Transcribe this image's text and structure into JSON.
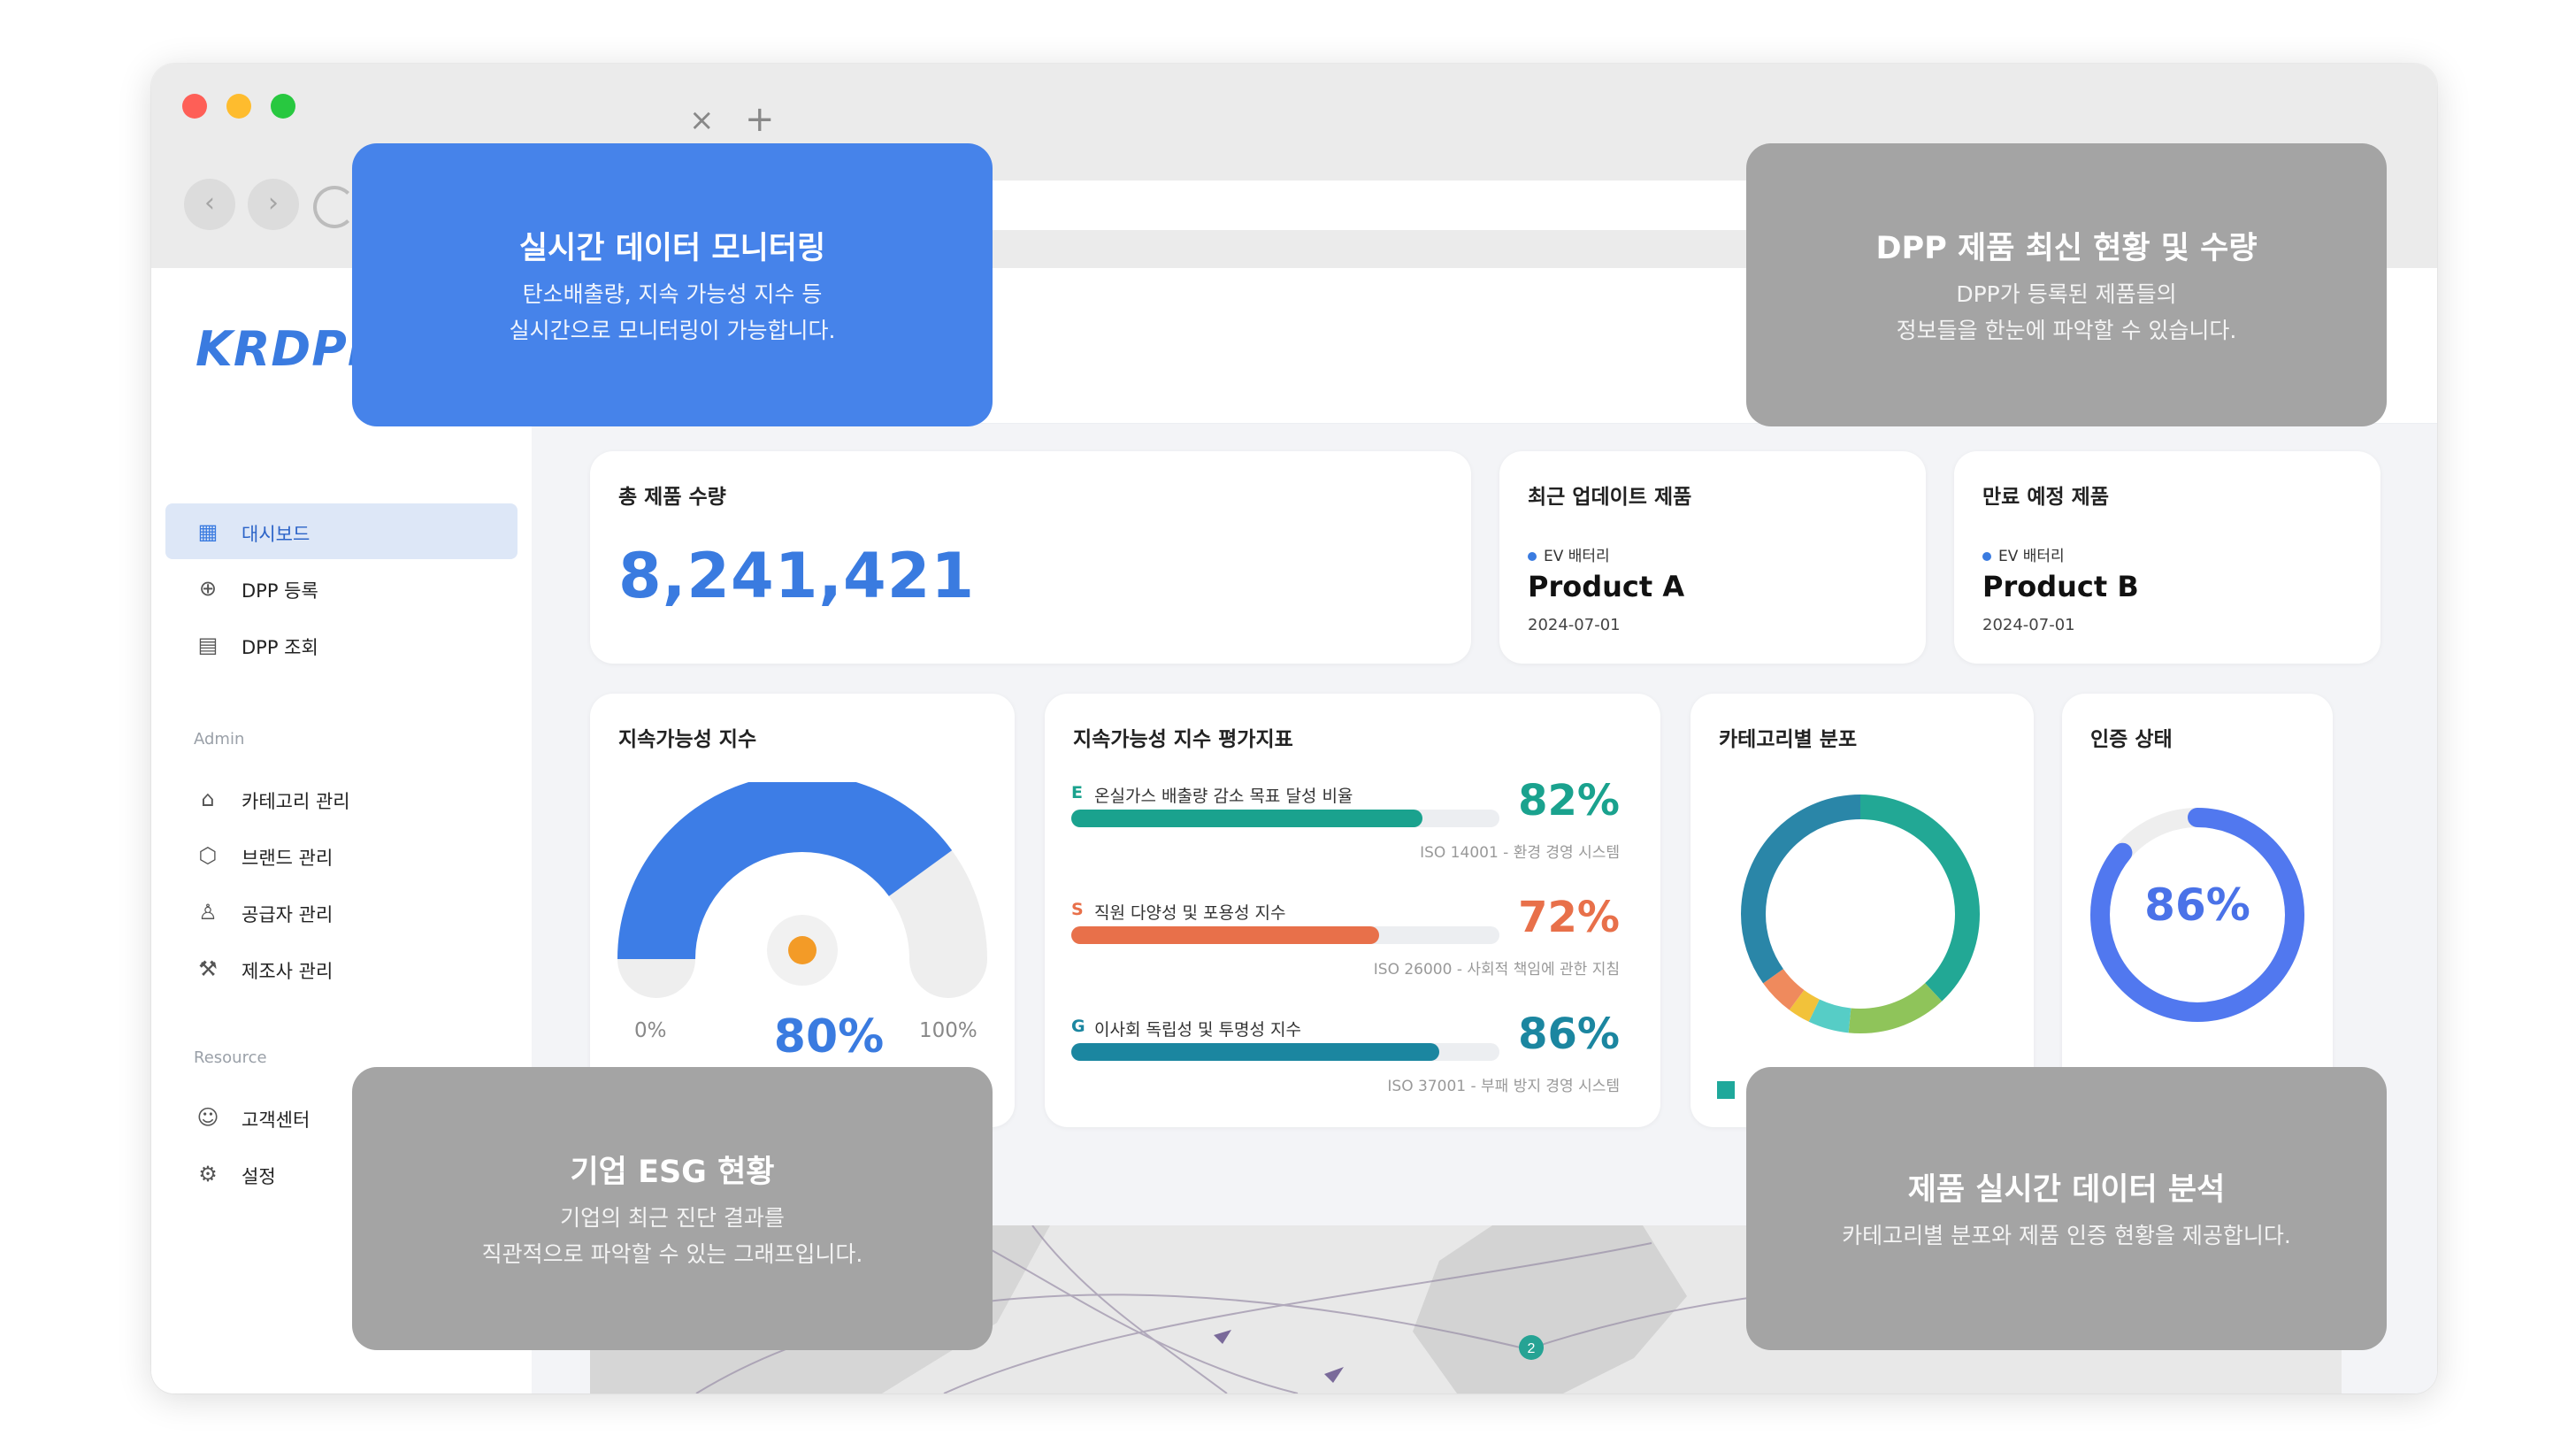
{
  "browser": {
    "tab_close": "×",
    "tab_new": "+",
    "back_icon": "‹",
    "forward_icon": "›"
  },
  "sidebar": {
    "logo": "KRDPP",
    "items": [
      {
        "label": "대시보드",
        "icon": "grid-icon",
        "glyph": "▦"
      },
      {
        "label": "DPP 등록",
        "icon": "add-page-icon",
        "glyph": "⊕"
      },
      {
        "label": "DPP 조회",
        "icon": "document-icon",
        "glyph": "▤"
      }
    ],
    "admin_label": "Admin",
    "admin_items": [
      {
        "label": "카테고리 관리",
        "icon": "category-icon",
        "glyph": "⌂"
      },
      {
        "label": "브랜드 관리",
        "icon": "box-icon",
        "glyph": "⬡"
      },
      {
        "label": "공급자 관리",
        "icon": "user-icon",
        "glyph": "♙"
      },
      {
        "label": "제조사 관리",
        "icon": "wrench-icon",
        "glyph": "⚒"
      }
    ],
    "resource_label": "Resource",
    "resource_items": [
      {
        "label": "고객센터",
        "icon": "support-icon",
        "glyph": "☺"
      },
      {
        "label": "설정",
        "icon": "gear-icon",
        "glyph": "⚙"
      }
    ]
  },
  "cards": {
    "total": {
      "title": "총 제품 수량",
      "value": "8,241,421"
    },
    "recent": {
      "title": "최근 업데이트 제품",
      "badge": "EV 배터리",
      "product": "Product A",
      "date": "2024-07-01"
    },
    "expiring": {
      "title": "만료 예정 제품",
      "badge": "EV 배터리",
      "product": "Product B",
      "date": "2024-07-01"
    },
    "sustainability": {
      "title": "지속가능성 지수",
      "min": "0%",
      "max": "100%",
      "value": "80%",
      "value_fraction": 0.8
    },
    "esg": {
      "title": "지속가능성 지수 평가지표",
      "rows": [
        {
          "letter": "E",
          "label": "온실가스 배출량 감소 목표 달성 비율",
          "pct": "82%",
          "fraction": 0.82,
          "iso": "ISO 14001 - 환경 경영 시스템",
          "color": "#1aa28e"
        },
        {
          "letter": "S",
          "label": "직원 다양성 및 포용성 지수",
          "pct": "72%",
          "fraction": 0.72,
          "iso": "ISO 26000 - 사회적 책임에 관한 지침",
          "color": "#e8704a"
        },
        {
          "letter": "G",
          "label": "이사회 독립성 및 투명성 지수",
          "pct": "86%",
          "fraction": 0.86,
          "iso": "ISO 37001 - 부패 방지 경영 시스템",
          "color": "#1b86a0"
        }
      ]
    },
    "category": {
      "title": "카테고리별 분포"
    },
    "certification": {
      "title": "인증 상태",
      "value": "86%",
      "fraction": 0.86
    }
  },
  "overlays": {
    "realtime": {
      "title": "실시간 데이터 모니터링",
      "desc": "탄소배출량, 지속 가능성 지수 등\n실시간으로 모니터링이 가능합니다."
    },
    "dpp_status": {
      "title": "DPP 제품 최신 현황 및 수량",
      "desc": "DPP가 등록된 제품들의\n정보들을 한눈에 파악할 수 있습니다."
    },
    "esg_status": {
      "title": "기업 ESG 현황",
      "desc": "기업의 최근 진단 결과를\n직관적으로 파악할 수 있는 그래프입니다."
    },
    "analysis": {
      "title": "제품 실시간 데이터 분석",
      "desc": "카테고리별 분포와 제품 인증 현황을 제공합니다."
    }
  },
  "map": {
    "markers": [
      "2",
      "2"
    ]
  },
  "colors": {
    "brand": "#3a7be0",
    "overlay_blue": "#4683ea",
    "overlay_gray": "#a4a4a4"
  }
}
